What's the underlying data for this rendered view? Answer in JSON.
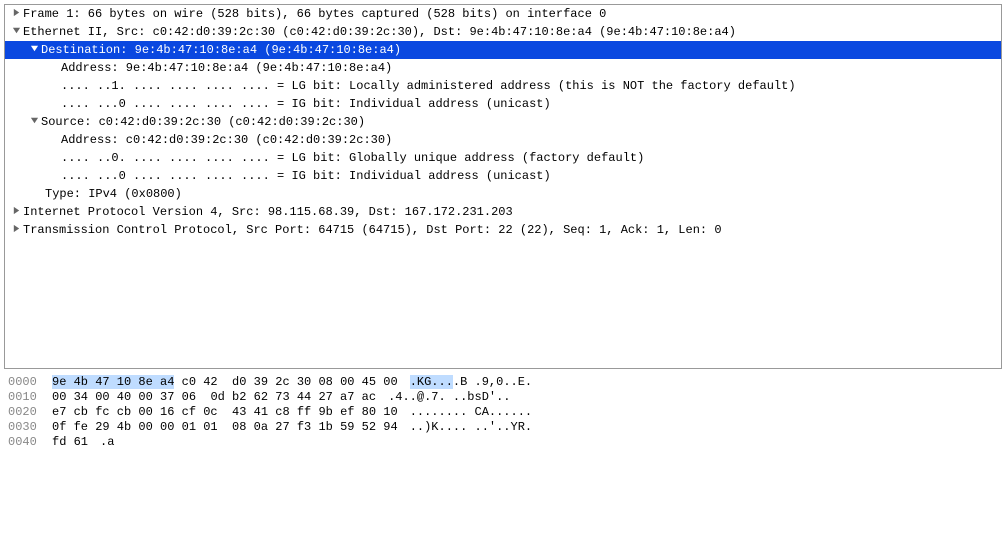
{
  "tree": {
    "frame": "Frame 1: 66 bytes on wire (528 bits), 66 bytes captured (528 bits) on interface 0",
    "ethernet": "Ethernet II, Src: c0:42:d0:39:2c:30 (c0:42:d0:39:2c:30), Dst: 9e:4b:47:10:8e:a4 (9e:4b:47:10:8e:a4)",
    "dest_header": "Destination: 9e:4b:47:10:8e:a4 (9e:4b:47:10:8e:a4)",
    "dest_addr": "Address: 9e:4b:47:10:8e:a4 (9e:4b:47:10:8e:a4)",
    "dest_lg": ".... ..1. .... .... .... .... = LG bit: Locally administered address (this is NOT the factory default)",
    "dest_ig": ".... ...0 .... .... .... .... = IG bit: Individual address (unicast)",
    "src_header": "Source: c0:42:d0:39:2c:30 (c0:42:d0:39:2c:30)",
    "src_addr": "Address: c0:42:d0:39:2c:30 (c0:42:d0:39:2c:30)",
    "src_lg": ".... ..0. .... .... .... .... = LG bit: Globally unique address (factory default)",
    "src_ig": ".... ...0 .... .... .... .... = IG bit: Individual address (unicast)",
    "type": "Type: IPv4 (0x0800)",
    "ip": "Internet Protocol Version 4, Src: 98.115.68.39, Dst: 167.172.231.203",
    "tcp": "Transmission Control Protocol, Src Port: 64715 (64715), Dst Port: 22 (22), Seq: 1, Ack: 1, Len: 0"
  },
  "hex": {
    "r0": {
      "off": "0000",
      "b1_hl": "9e 4b 47 10 8e a4",
      "b1_rest": " c0 42",
      "b2": "d0 39 2c 30 08 00 45 00",
      "a_hl": ".KG...",
      "a_rest": ".B .9,0..E."
    },
    "r1": {
      "off": "0010",
      "b1": "00 34 00 40 00 37 06",
      "b2": "0d b2 62 73 44 27 a7 ac",
      "a": ".4..@.7. ..bsD'.."
    },
    "r2": {
      "off": "0020",
      "b1": "e7 cb fc cb 00 16 cf 0c",
      "b2": "43 41 c8 ff 9b ef 80 10",
      "a": "........ CA......"
    },
    "r3": {
      "off": "0030",
      "b1": "0f fe 29 4b 00 00 01 01",
      "b2": "08 0a 27 f3 1b 59 52 94",
      "a": "..)K.... ..'..YR."
    },
    "r4": {
      "off": "0040",
      "b1": "fd 61",
      "b2": "",
      "a": ".a"
    }
  }
}
